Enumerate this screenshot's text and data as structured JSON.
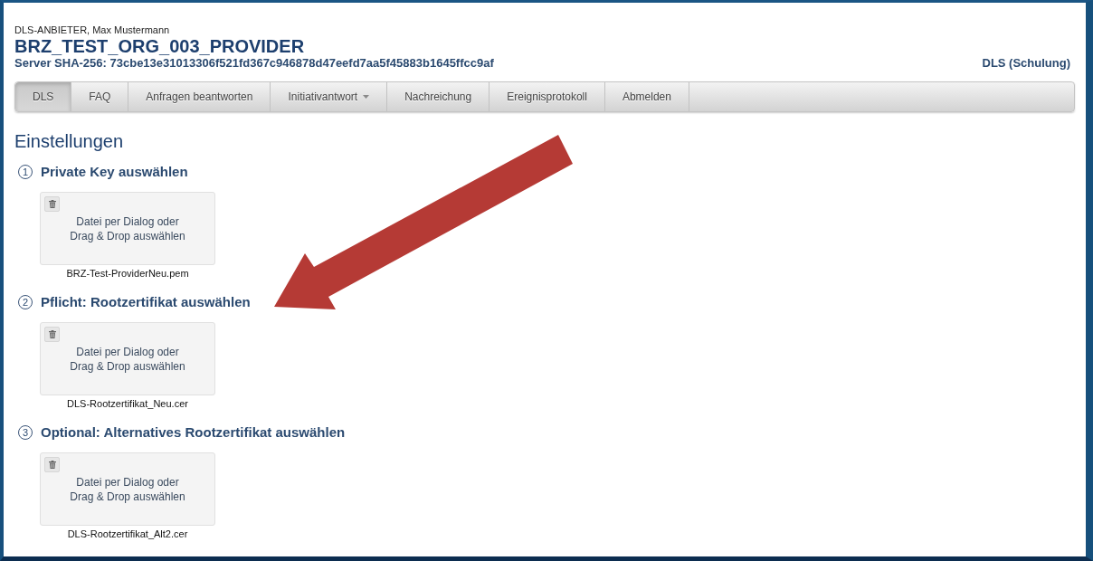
{
  "header": {
    "user": "DLS-ANBIETER, Max Mustermann",
    "organization": "BRZ_TEST_ORG_003_PROVIDER",
    "server_hash": "Server SHA-256: 73cbe13e31013306f521fd367c946878d47eefd7aa5f45883b1645ffcc9af",
    "environment": "DLS (Schulung)"
  },
  "nav": [
    {
      "label": "DLS",
      "selected": true,
      "kind": "link"
    },
    {
      "label": "FAQ",
      "selected": false,
      "kind": "link"
    },
    {
      "label": "Anfragen beantworten",
      "selected": false,
      "kind": "link"
    },
    {
      "label": "Initiativantwort",
      "selected": false,
      "kind": "dropdown"
    },
    {
      "label": "Nachreichung",
      "selected": false,
      "kind": "link"
    },
    {
      "label": "Ereignisprotokoll",
      "selected": false,
      "kind": "link"
    },
    {
      "label": "Abmelden",
      "selected": false,
      "kind": "link"
    }
  ],
  "page_title": "Einstellungen",
  "steps": [
    {
      "number": "1",
      "title": "Private Key auswählen",
      "dropzone_text": "Datei per Dialog oder\nDrag & Drop auswählen",
      "file_name": "BRZ-Test-ProviderNeu.pem"
    },
    {
      "number": "2",
      "title": "Pflicht: Rootzertifikat auswählen",
      "dropzone_text": "Datei per Dialog oder\nDrag & Drop auswählen",
      "file_name": "DLS-Rootzertifikat_Neu.cer"
    },
    {
      "number": "3",
      "title": "Optional: Alternatives Rootzertifikat auswählen",
      "dropzone_text": "Datei per Dialog oder\nDrag & Drop auswählen",
      "file_name": "DLS-Rootzertifikat_Alt2.cer"
    }
  ]
}
